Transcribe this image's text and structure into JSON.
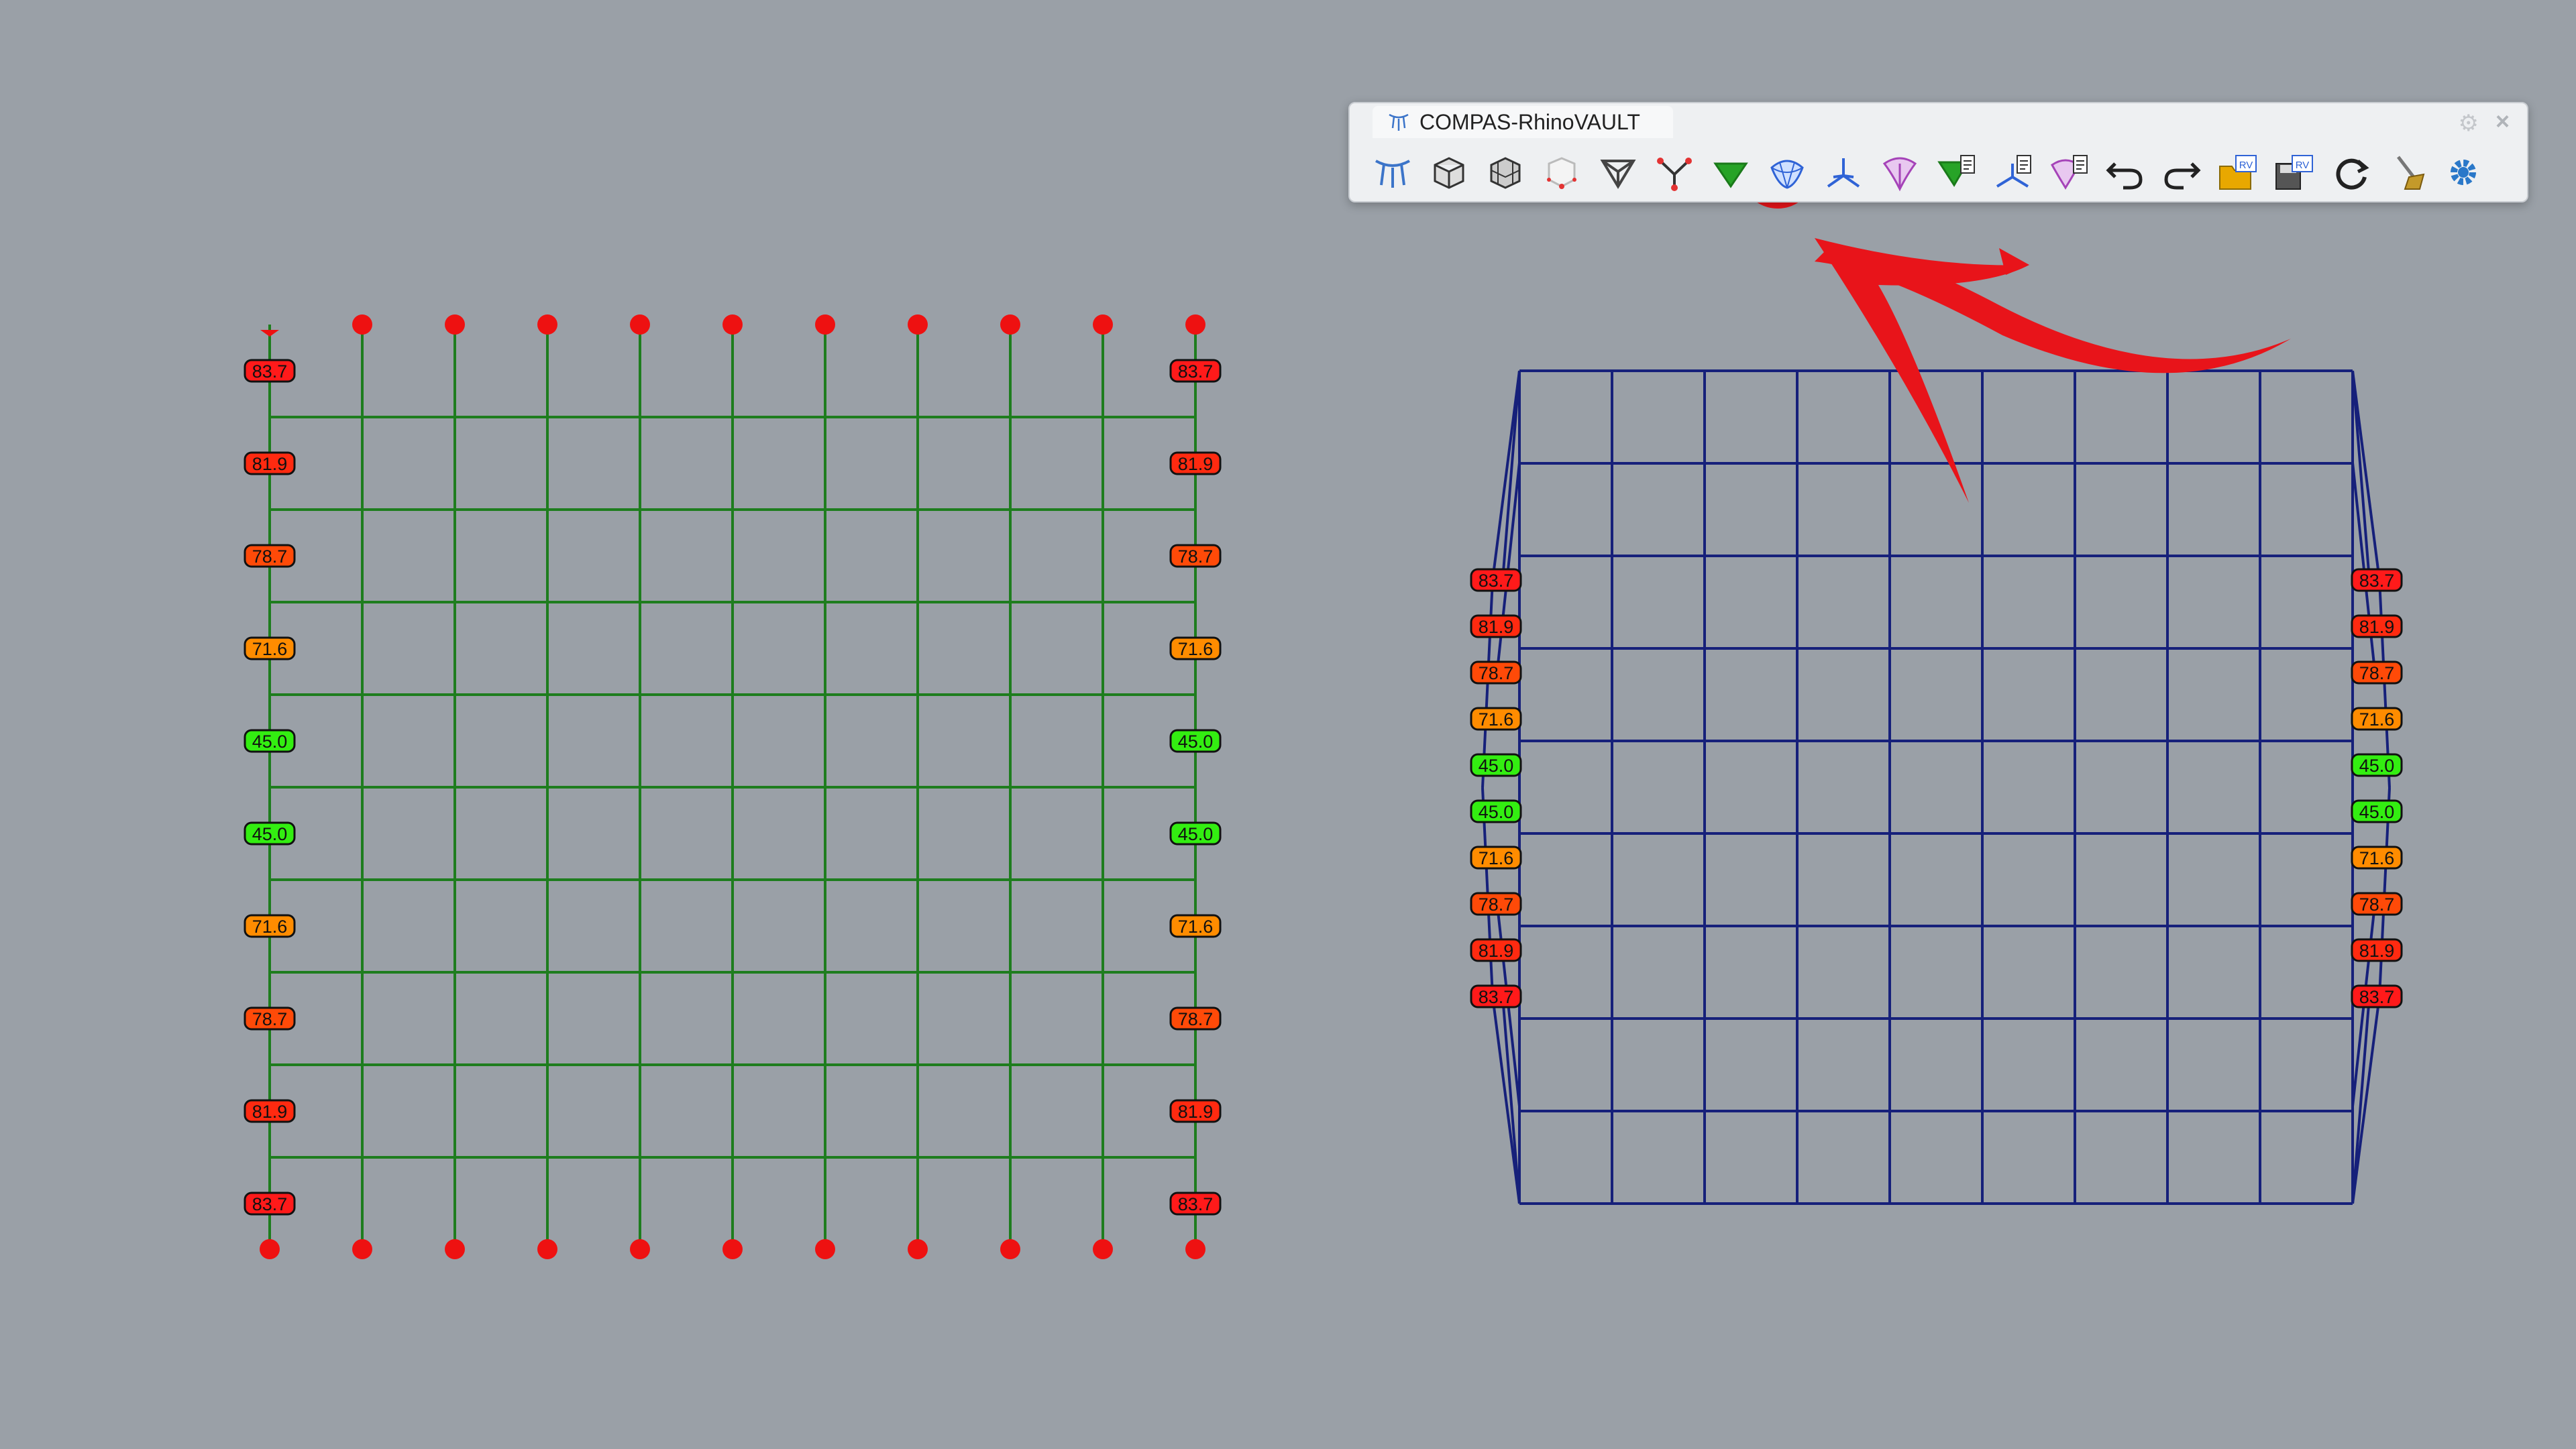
{
  "toolbar": {
    "title": "COMPAS-RhinoVAULT",
    "buttons": [
      {
        "name": "rhinovault-init-icon",
        "label": "",
        "color": "#3b74c9"
      },
      {
        "name": "form-from-mesh-icon",
        "label": "",
        "color": "#555555"
      },
      {
        "name": "form-from-surface-icon",
        "label": "",
        "color": "#555555"
      },
      {
        "name": "form-from-skeleton-icon",
        "label": "",
        "color": "#e33333"
      },
      {
        "name": "form-from-lines-icon",
        "label": "",
        "color": "#444444"
      },
      {
        "name": "supports-icon",
        "label": "",
        "color": "#e33333"
      },
      {
        "name": "force-from-form-icon",
        "label": "",
        "color": "#27a327"
      },
      {
        "name": "thrust-from-form-icon",
        "label": "",
        "color": "#2f63d6",
        "highlighted": true
      },
      {
        "name": "horizontal-equilibrium-icon",
        "label": "",
        "color": "#2f63d6"
      },
      {
        "name": "vertical-equilibrium-icon",
        "label": "",
        "color": "#a543b8"
      },
      {
        "name": "modify-form-icon",
        "label": "",
        "color": "#27a327"
      },
      {
        "name": "modify-force-icon",
        "label": "",
        "color": "#2f63d6"
      },
      {
        "name": "modify-thrust-icon",
        "label": "",
        "color": "#a543b8"
      },
      {
        "name": "undo-icon",
        "label": "",
        "color": "#222222"
      },
      {
        "name": "redo-icon",
        "label": "",
        "color": "#222222"
      },
      {
        "name": "open-session-icon",
        "label": "RV",
        "color": "#e8a800"
      },
      {
        "name": "save-session-icon",
        "label": "RV",
        "color": "#2f63d6"
      },
      {
        "name": "refresh-icon",
        "label": "",
        "color": "#222222"
      },
      {
        "name": "clear-icon",
        "label": "",
        "color": "#c49a2a"
      },
      {
        "name": "settings-icon",
        "label": "",
        "color": "#2a78c9"
      }
    ]
  },
  "annotation": {
    "color": "#e8141a"
  },
  "form_diagram": {
    "line_color": "#1e7d1e",
    "support_color": "#ee1111",
    "left_labels": [
      "83.7",
      "81.9",
      "78.7",
      "71.6",
      "45.0",
      "45.0",
      "71.6",
      "78.7",
      "81.9",
      "83.7"
    ],
    "right_labels": [
      "83.7",
      "81.9",
      "78.7",
      "71.6",
      "45.0",
      "45.0",
      "71.6",
      "78.7",
      "81.9",
      "83.7"
    ],
    "label_colors": [
      "#ff1a1a",
      "#ff2a10",
      "#ff4a08",
      "#ff8c00",
      "#33ee11",
      "#33ee11",
      "#ff8c00",
      "#ff4a08",
      "#ff2a10",
      "#ff1a1a"
    ]
  },
  "force_diagram": {
    "line_color": "#16207a",
    "left_labels": [
      "83.7",
      "81.9",
      "78.7",
      "71.6",
      "45.0",
      "45.0",
      "71.6",
      "78.7",
      "81.9",
      "83.7"
    ],
    "right_labels": [
      "83.7",
      "81.9",
      "78.7",
      "71.6",
      "45.0",
      "45.0",
      "71.6",
      "78.7",
      "81.9",
      "83.7"
    ],
    "label_colors": [
      "#ff1a1a",
      "#ff2a10",
      "#ff4a08",
      "#ff8c00",
      "#33ee11",
      "#33ee11",
      "#ff8c00",
      "#ff4a08",
      "#ff2a10",
      "#ff1a1a"
    ]
  }
}
